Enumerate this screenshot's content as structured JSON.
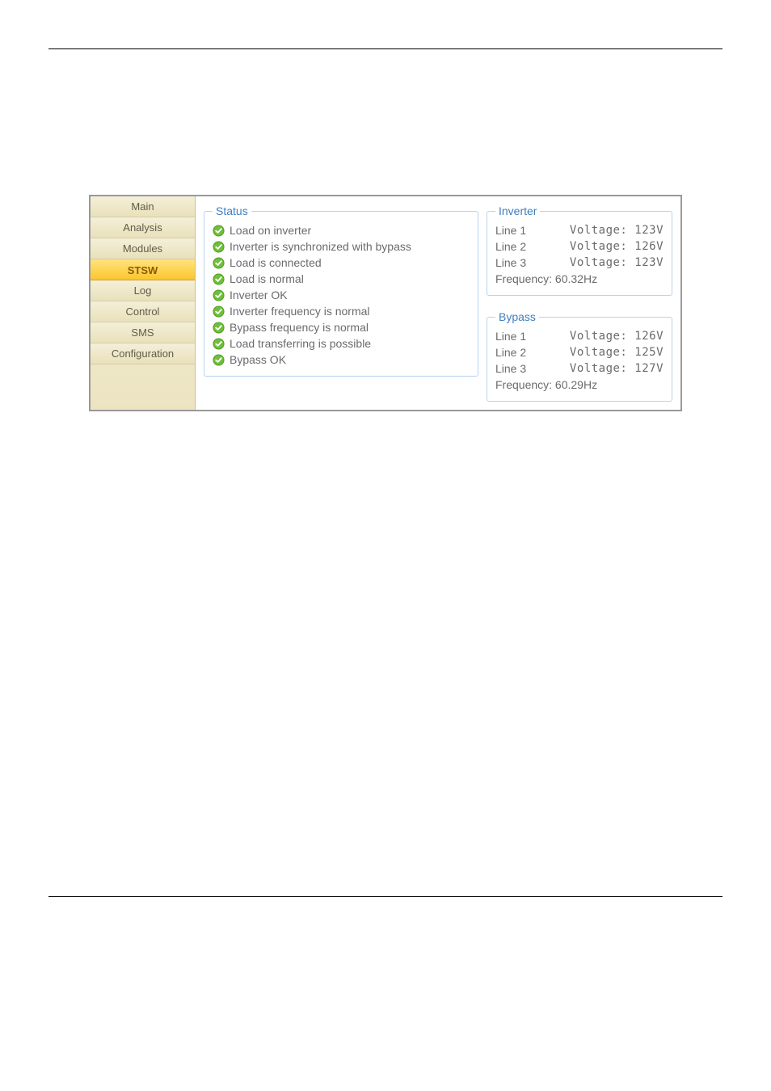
{
  "sidebar": {
    "items": [
      {
        "label": "Main",
        "active": false
      },
      {
        "label": "Analysis",
        "active": false
      },
      {
        "label": "Modules",
        "active": false
      },
      {
        "label": "STSW",
        "active": true
      },
      {
        "label": "Log",
        "active": false
      },
      {
        "label": "Control",
        "active": false
      },
      {
        "label": "SMS",
        "active": false
      },
      {
        "label": "Configuration",
        "active": false
      }
    ]
  },
  "status_panel": {
    "legend": "Status",
    "items": [
      "Load on inverter",
      "Inverter is synchronized with bypass",
      "Load is connected",
      "Load is normal",
      "Inverter OK",
      "Inverter frequency is normal",
      "Bypass frequency is normal",
      "Load transferring is possible",
      "Bypass OK"
    ]
  },
  "inverter_panel": {
    "legend": "Inverter",
    "lines": [
      {
        "label": "Line 1",
        "value": "Voltage: 123V"
      },
      {
        "label": "Line 2",
        "value": "Voltage: 126V"
      },
      {
        "label": "Line 3",
        "value": "Voltage: 123V"
      }
    ],
    "frequency": "Frequency: 60.32Hz"
  },
  "bypass_panel": {
    "legend": "Bypass",
    "lines": [
      {
        "label": "Line 1",
        "value": "Voltage: 126V"
      },
      {
        "label": "Line 2",
        "value": "Voltage: 125V"
      },
      {
        "label": "Line 3",
        "value": "Voltage: 127V"
      }
    ],
    "frequency": "Frequency: 60.29Hz"
  }
}
